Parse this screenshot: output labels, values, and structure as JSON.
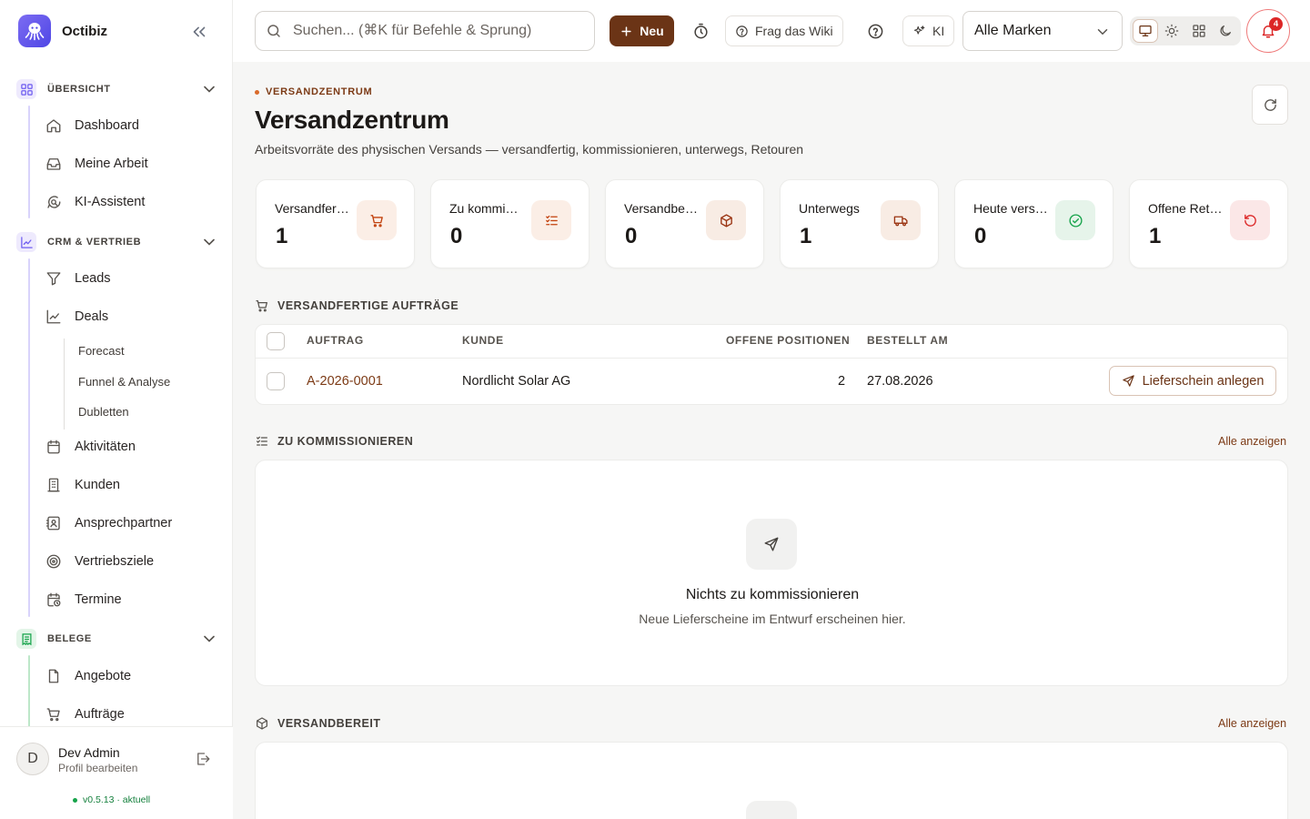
{
  "app": {
    "name": "Octibiz"
  },
  "sidebar": {
    "sections": [
      {
        "label": "ÜBERSICHT",
        "items": [
          "Dashboard",
          "Meine Arbeit",
          "KI-Assistent"
        ]
      },
      {
        "label": "CRM & VERTRIEB",
        "items": [
          "Leads",
          "Deals",
          "Aktivitäten",
          "Kunden",
          "Ansprechpartner",
          "Vertriebsziele",
          "Termine"
        ],
        "subitems": [
          "Forecast",
          "Funnel & Analyse",
          "Dubletten"
        ]
      },
      {
        "label": "BELEGE",
        "items": [
          "Angebote",
          "Aufträge"
        ]
      }
    ],
    "user": {
      "initial": "D",
      "name": "Dev Admin",
      "sub": "Profil bearbeiten"
    },
    "version": "v0.5.13 · aktuell"
  },
  "topbar": {
    "search_placeholder": "Suchen... (⌘K für Befehle & Sprung)",
    "new_label": "Neu",
    "wiki_label": "Frag das Wiki",
    "ai_label": "KI",
    "brand_select": "Alle Marken",
    "notification_count": "4"
  },
  "page": {
    "eyebrow": "VERSANDZENTRUM",
    "title": "Versandzentrum",
    "subtitle": "Arbeitsvorräte des physischen Versands — versandfertig, kommissionieren, unterwegs, Retouren"
  },
  "kpis": [
    {
      "label": "Versandfertig",
      "value": "1",
      "icon": "cart-icon",
      "color": "#c2410c",
      "bg": "#fbeee6"
    },
    {
      "label": "Zu kommissionieren",
      "value": "0",
      "icon": "list-checks-icon",
      "color": "#c2410c",
      "bg": "#fbeee6"
    },
    {
      "label": "Versandbereit",
      "value": "0",
      "icon": "package-icon",
      "color": "#9a3412",
      "bg": "#f8ece4"
    },
    {
      "label": "Unterwegs",
      "value": "1",
      "icon": "truck-icon",
      "color": "#9a3412",
      "bg": "#f8ece4"
    },
    {
      "label": "Heute versendet",
      "value": "0",
      "icon": "check-circle-icon",
      "color": "#16a34a",
      "bg": "#e6f4ea"
    },
    {
      "label": "Offene Retouren",
      "value": "1",
      "icon": "undo-icon",
      "color": "#dc2626",
      "bg": "#fbe7e7"
    }
  ],
  "sections": {
    "ready": {
      "title": "VERSANDFERTIGE AUFTRÄGE",
      "columns": [
        "AUFTRAG",
        "KUNDE",
        "OFFENE POSITIONEN",
        "BESTELLT AM"
      ],
      "rows": [
        {
          "order": "A-2026-0001",
          "customer": "Nordlicht Solar AG",
          "open_positions": "2",
          "ordered_at": "27.08.2026",
          "action": "Lieferschein anlegen"
        }
      ]
    },
    "picking": {
      "title": "ZU KOMMISSIONIEREN",
      "show_all": "Alle anzeigen",
      "empty_title": "Nichts zu kommissionieren",
      "empty_sub": "Neue Lieferscheine im Entwurf erscheinen hier."
    },
    "shipready": {
      "title": "VERSANDBEREIT",
      "show_all": "Alle anzeigen"
    }
  },
  "colors": {
    "accent": "#6b3416",
    "accent_text": "#7c3a15",
    "danger": "#dc2626",
    "success": "#16a34a"
  }
}
